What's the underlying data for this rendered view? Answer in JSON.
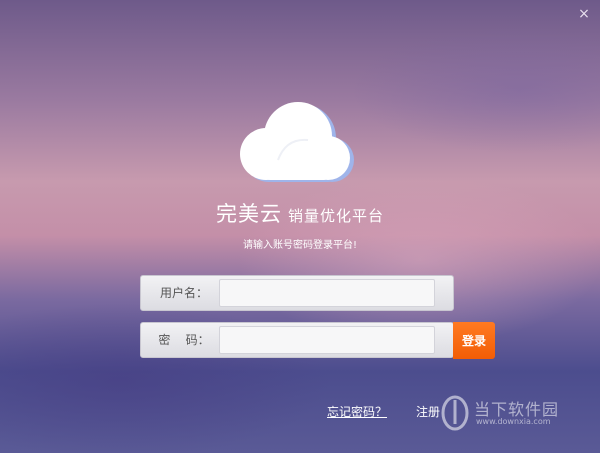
{
  "window": {
    "close_symbol": "×"
  },
  "brand": {
    "name": "完美云",
    "tagline": "销量优化平台"
  },
  "prompt": "请输入账号密码登录平台!",
  "form": {
    "username_label": "用户名：",
    "username_value": "",
    "password_label": "密    码：",
    "password_value": "",
    "login_label": "登录"
  },
  "links": {
    "forgot_password": "忘记密码？",
    "register": "注册"
  },
  "watermark": {
    "text": "当下软件园",
    "url": "www.downxia.com"
  },
  "colors": {
    "login_button": "#f56a10",
    "text_light": "#ffffff"
  },
  "icons": [
    "close-icon",
    "cloud-logo-icon",
    "watermark-logo-icon"
  ]
}
